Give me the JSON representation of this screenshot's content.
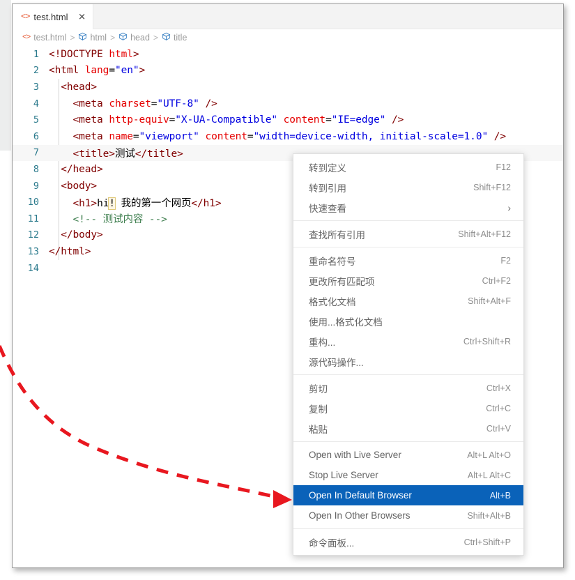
{
  "window": {
    "tab": {
      "label": "test.html",
      "icon": "html-file-icon",
      "close_icon": "close-icon"
    },
    "breadcrumb": {
      "file_icon": "html-file-icon",
      "items": [
        {
          "label": "test.html",
          "icon": "html-file-icon"
        },
        {
          "label": "html",
          "icon": "symbol-cube-icon"
        },
        {
          "label": "head",
          "icon": "symbol-cube-icon"
        },
        {
          "label": "title",
          "icon": "symbol-cube-icon"
        }
      ],
      "separator": ">"
    }
  },
  "editor": {
    "line_numbers": [
      1,
      2,
      3,
      4,
      5,
      6,
      7,
      8,
      9,
      10,
      11,
      12,
      13,
      14
    ],
    "lines": [
      {
        "n": 1,
        "text": "<!DOCTYPE html>"
      },
      {
        "n": 2,
        "text": "<html lang=\"en\">"
      },
      {
        "n": 3,
        "text": "  <head>"
      },
      {
        "n": 4,
        "text": "    <meta charset=\"UTF-8\" />"
      },
      {
        "n": 5,
        "text": "    <meta http-equiv=\"X-UA-Compatible\" content=\"IE=edge\" />"
      },
      {
        "n": 6,
        "text": "    <meta name=\"viewport\" content=\"width=device-width, initial-scale=1.0\" />"
      },
      {
        "n": 7,
        "text": "    <title>测试</title>"
      },
      {
        "n": 8,
        "text": "  </head>"
      },
      {
        "n": 9,
        "text": "  <body>"
      },
      {
        "n": 10,
        "text": "    <h1>hi! 我的第一个网页</h1>"
      },
      {
        "n": 11,
        "text": "    <!-- 测试内容 -->"
      },
      {
        "n": 12,
        "text": "  </body>"
      },
      {
        "n": 13,
        "text": "</html>"
      },
      {
        "n": 14,
        "text": ""
      }
    ]
  },
  "context_menu": {
    "groups": [
      {
        "items": [
          {
            "label": "转到定义",
            "shortcut": "F12"
          },
          {
            "label": "转到引用",
            "shortcut": "Shift+F12"
          },
          {
            "label": "快速查看",
            "shortcut": "",
            "submenu_icon": "chevron-right-icon"
          }
        ]
      },
      {
        "items": [
          {
            "label": "查找所有引用",
            "shortcut": "Shift+Alt+F12"
          }
        ]
      },
      {
        "items": [
          {
            "label": "重命名符号",
            "shortcut": "F2"
          },
          {
            "label": "更改所有匹配项",
            "shortcut": "Ctrl+F2"
          },
          {
            "label": "格式化文档",
            "shortcut": "Shift+Alt+F"
          },
          {
            "label": "使用...格式化文档",
            "shortcut": ""
          },
          {
            "label": "重构...",
            "shortcut": "Ctrl+Shift+R"
          },
          {
            "label": "源代码操作...",
            "shortcut": ""
          }
        ]
      },
      {
        "items": [
          {
            "label": "剪切",
            "shortcut": "Ctrl+X"
          },
          {
            "label": "复制",
            "shortcut": "Ctrl+C"
          },
          {
            "label": "粘贴",
            "shortcut": "Ctrl+V"
          }
        ]
      },
      {
        "items": [
          {
            "label": "Open with Live Server",
            "shortcut": "Alt+L Alt+O"
          },
          {
            "label": "Stop Live Server",
            "shortcut": "Alt+L Alt+C"
          },
          {
            "label": "Open In Default Browser",
            "shortcut": "Alt+B",
            "selected": true
          },
          {
            "label": "Open In Other Browsers",
            "shortcut": "Shift+Alt+B"
          }
        ]
      },
      {
        "items": [
          {
            "label": "命令面板...",
            "shortcut": "Ctrl+Shift+P"
          }
        ]
      }
    ]
  },
  "annotation": {
    "arrow": "red-dashed-arrow",
    "color": "#e8171f",
    "points_to": "Open In Default Browser"
  },
  "colors": {
    "selection_blue": "#0a62b9",
    "tagname_maroon": "#800000",
    "attribute_red": "#e50000",
    "value_blue": "#0000e0",
    "comment_green": "#3f7f4f",
    "linenumber_teal": "#2b7a8c",
    "tabbar_gray": "#f3f3f3",
    "annotation_red": "#e8171f"
  }
}
